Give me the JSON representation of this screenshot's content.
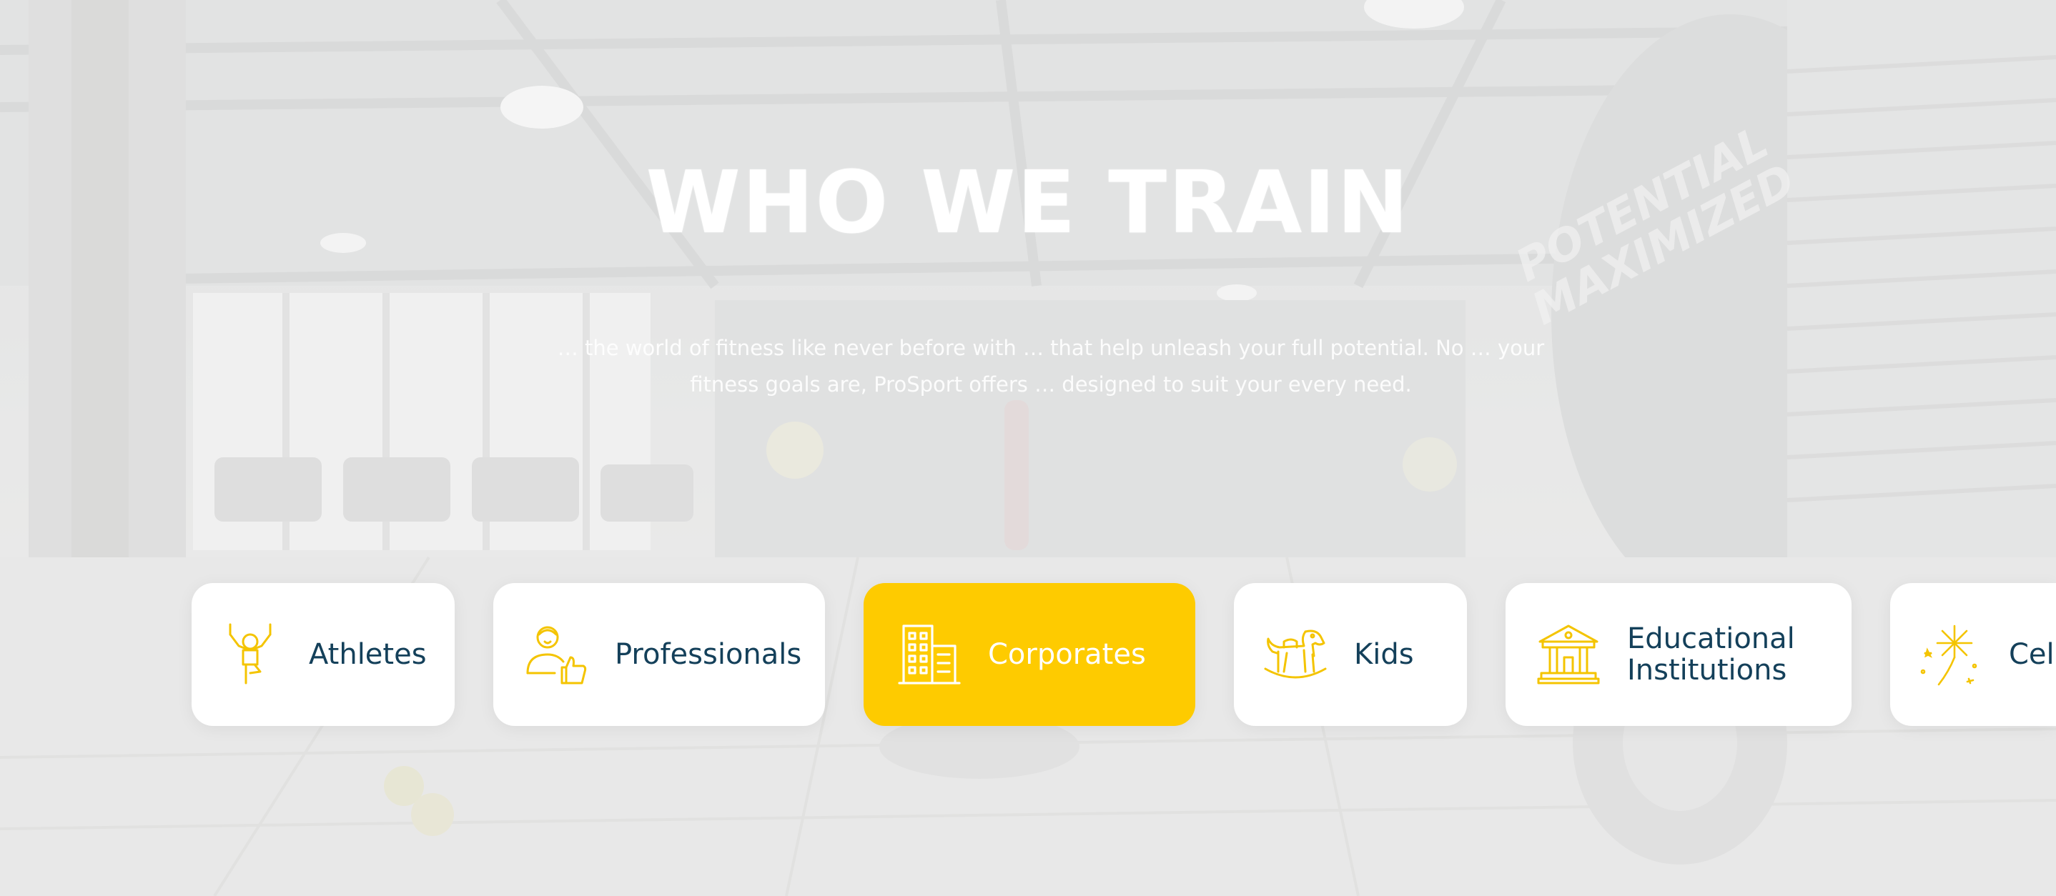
{
  "section": {
    "title": "WHO WE TRAIN",
    "description": "… the world of fitness like never before with … that help unleash your full potential. No … your fitness goals are, ProSport offers … designed to suit your every need."
  },
  "categories": [
    {
      "label": "Athletes",
      "icon": "athlete-icon",
      "active": false
    },
    {
      "label": "Professionals",
      "icon": "professional-thumbs-up-icon",
      "active": false
    },
    {
      "label": "Corporates",
      "icon": "office-building-icon",
      "active": true
    },
    {
      "label": "Kids",
      "icon": "rocking-horse-icon",
      "active": false
    },
    {
      "label_line1": "Educational",
      "label_line2": "Institutions",
      "icon": "institution-building-icon",
      "active": false
    },
    {
      "label": "Cel",
      "icon": "fireworks-icon",
      "active": false
    }
  ],
  "background": {
    "wall_text_line1": "POTENTIAL",
    "wall_text_line2": "MAXIMIZED"
  },
  "colors": {
    "accent": "#fecb00",
    "text_dark": "#14405a",
    "card_bg": "#ffffff",
    "icon_color": "#f4c400"
  }
}
